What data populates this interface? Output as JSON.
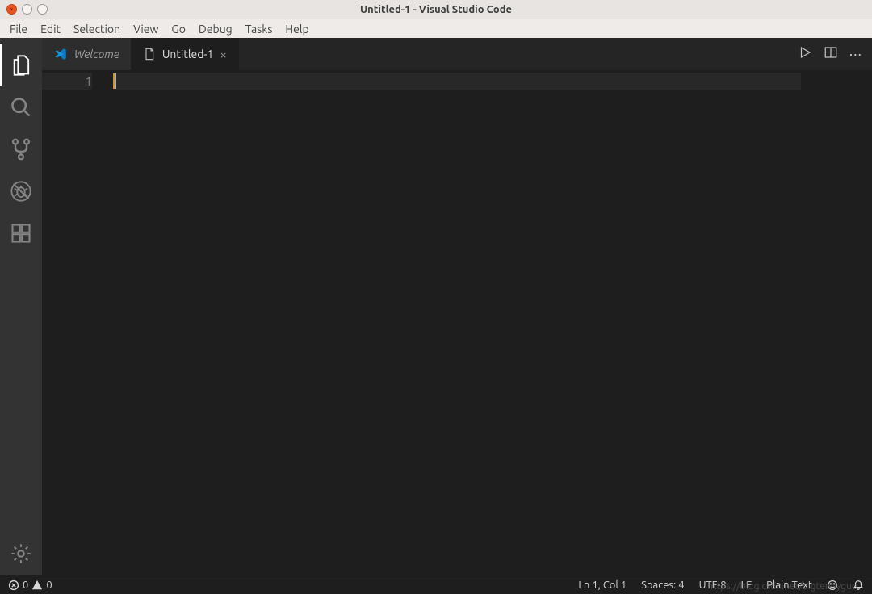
{
  "window_title": "Untitled-1 - Visual Studio Code",
  "menubar": [
    "File",
    "Edit",
    "Selection",
    "View",
    "Go",
    "Debug",
    "Tasks",
    "Help"
  ],
  "activitybar": {
    "items": [
      "explorer",
      "search",
      "source-control",
      "debug",
      "extensions"
    ],
    "bottom": [
      "settings"
    ]
  },
  "tabs": {
    "welcome": {
      "label": "Welcome"
    },
    "untitled": {
      "label": "Untitled-1"
    }
  },
  "editor": {
    "line_number": "1"
  },
  "statusbar": {
    "errors": "0",
    "warnings": "0",
    "cursor": "Ln 1, Col 1",
    "indent": "Spaces: 4",
    "encoding": "UTF-8",
    "eol": "LF",
    "language": "Plain Text"
  },
  "watermark": "https://blog.csdn.net/bigtennyguo"
}
